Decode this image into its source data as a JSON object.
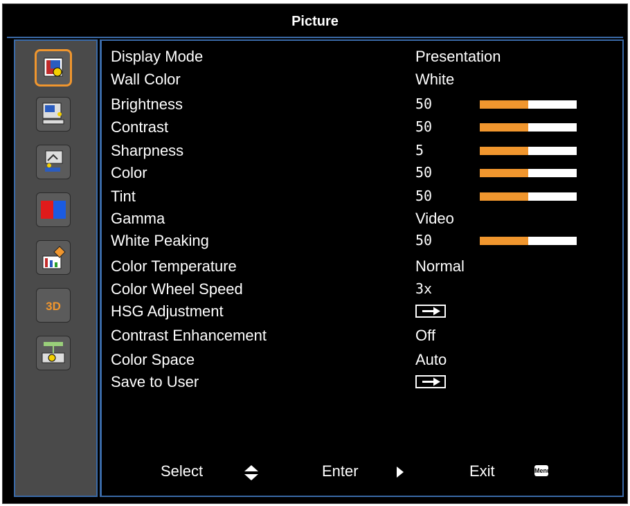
{
  "title": "Picture",
  "sidebar": {
    "items": [
      {
        "icon": "picture-icon",
        "selected": true
      },
      {
        "icon": "screen-icon",
        "selected": false
      },
      {
        "icon": "setting-icon",
        "selected": false
      },
      {
        "icon": "volume-color-icon",
        "selected": false
      },
      {
        "icon": "options-icon",
        "selected": false
      },
      {
        "icon": "3d-icon",
        "label": "3D",
        "selected": false
      },
      {
        "icon": "lan-icon",
        "selected": false
      }
    ]
  },
  "menu": [
    {
      "label": "Display Mode",
      "value": "Presentation"
    },
    {
      "label": "Wall Color",
      "value": "White"
    },
    {
      "label": "Brightness",
      "value": "50",
      "level": 0.5
    },
    {
      "label": "Contrast",
      "value": "50",
      "level": 0.5
    },
    {
      "label": "Sharpness",
      "value": "5",
      "level": 0.5
    },
    {
      "label": "Color",
      "value": "50",
      "level": 0.5
    },
    {
      "label": "Tint",
      "value": "50",
      "level": 0.5
    },
    {
      "label": "Gamma",
      "value": "Video"
    },
    {
      "label": "White Peaking",
      "value": "50",
      "level": 0.5
    },
    {
      "label": "Color Temperature",
      "value": "Normal"
    },
    {
      "label": "Color Wheel Speed",
      "value": "3x"
    },
    {
      "label": "HSG Adjustment",
      "value": "",
      "arrow": true
    },
    {
      "label": "Contrast Enhancement",
      "value": "Off"
    },
    {
      "label": "Color Space",
      "value": "Auto"
    },
    {
      "label": "Save to User",
      "value": "",
      "arrow": true
    }
  ],
  "footer": {
    "select_label": "Select",
    "enter_label": "Enter",
    "exit_label": "Exit",
    "menu_key_label": "Menu"
  },
  "colors": {
    "accent": "#f0962e",
    "border": "#3a6aa8",
    "background": "#000000",
    "sidebar": "#4a4a4a"
  }
}
